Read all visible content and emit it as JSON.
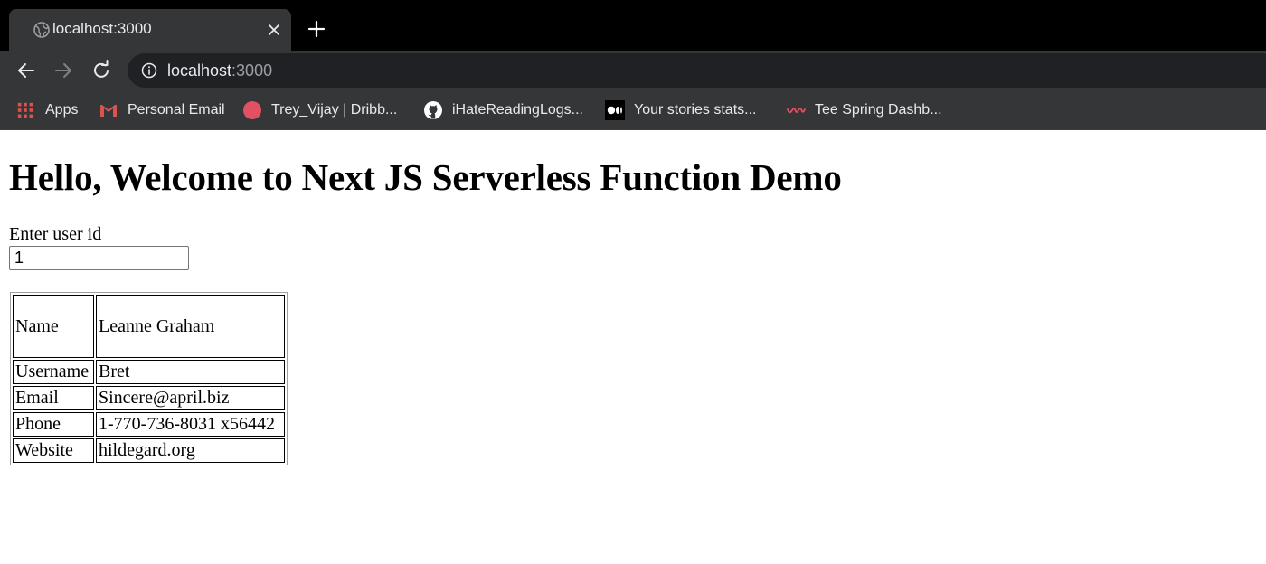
{
  "browser": {
    "tab": {
      "title": "localhost:3000"
    },
    "address_bar": {
      "host": "localhost",
      "port": ":3000"
    },
    "bookmarks": [
      {
        "label": "Apps",
        "icon": "apps-grid-icon"
      },
      {
        "label": "Personal Email",
        "icon": "gmail-icon"
      },
      {
        "label": "Trey_Vijay | Dribb...",
        "icon": "dribbble-icon"
      },
      {
        "label": "iHateReadingLogs...",
        "icon": "github-icon"
      },
      {
        "label": "Your stories stats...",
        "icon": "medium-icon"
      },
      {
        "label": "Tee Spring Dashb...",
        "icon": "teespring-icon"
      }
    ]
  },
  "page": {
    "heading": "Hello, Welcome to Next JS Serverless Function Demo",
    "user_id_label": "Enter user id",
    "user_id_value": "1",
    "user_table": [
      {
        "key": "Name",
        "value": "Leanne Graham"
      },
      {
        "key": "Username",
        "value": "Bret"
      },
      {
        "key": "Email",
        "value": "Sincere@april.biz"
      },
      {
        "key": "Phone",
        "value": "1-770-736-8031 x56442"
      },
      {
        "key": "Website",
        "value": "hildegard.org"
      }
    ]
  },
  "colors": {
    "tabstrip": "#000000",
    "toolbar": "#353638",
    "omnibox": "#202124",
    "chrome_text": "#e8eaed",
    "apps_icon": "#d9534f",
    "gmail_icon": "#d9534f",
    "dribbble_icon": "#e05263",
    "teespring_icon": "#e05263"
  }
}
